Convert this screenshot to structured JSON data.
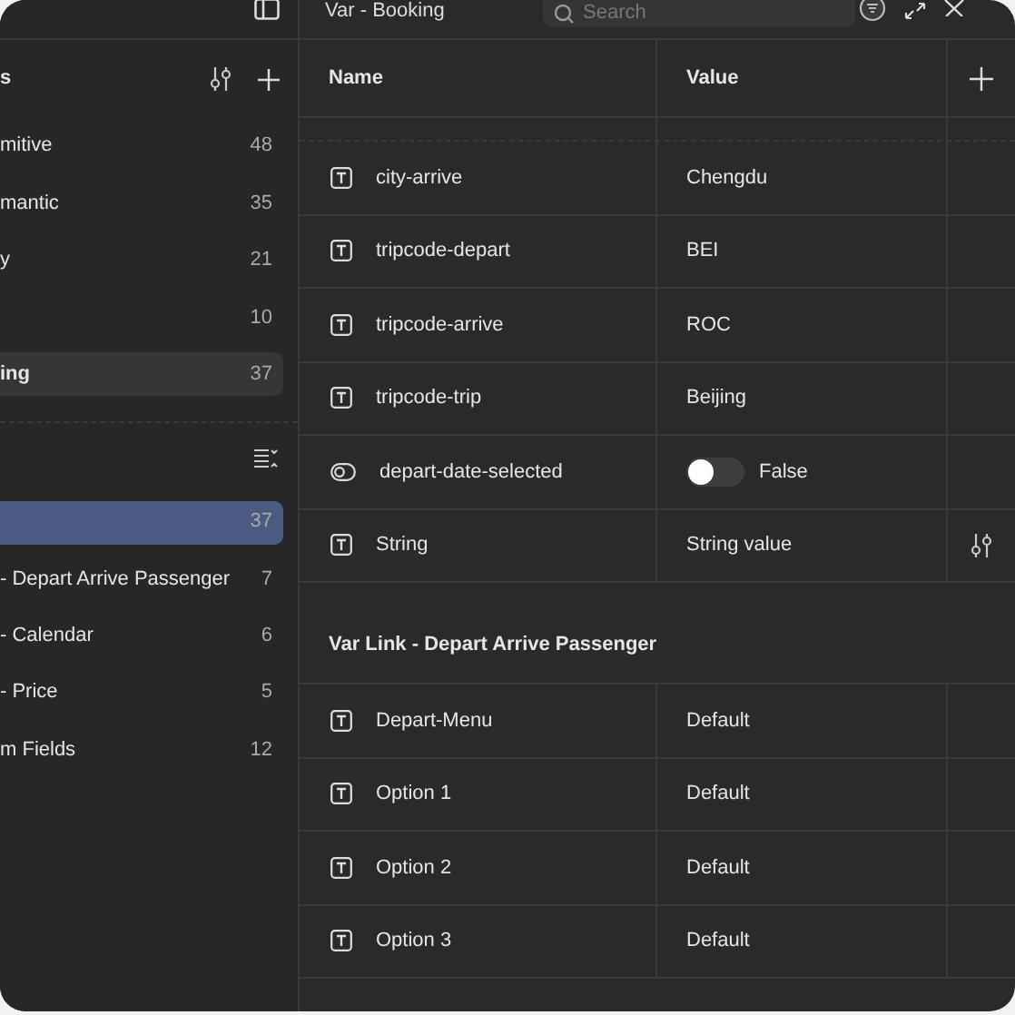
{
  "window": {
    "title": "Var - Booking"
  },
  "search": {
    "placeholder": "Search"
  },
  "sidebar": {
    "groups": [
      {
        "header": "s",
        "items": [
          {
            "label": "mitive",
            "count": "48",
            "selected": false
          },
          {
            "label": "mantic",
            "count": "35",
            "selected": false
          },
          {
            "label": "y",
            "count": "21",
            "selected": false
          },
          {
            "count": "10",
            "selected": false
          },
          {
            "label": "ing",
            "count": "37",
            "selected": true
          }
        ]
      },
      {
        "items": [
          {
            "count": "37",
            "selected": true
          },
          {
            "label": "- Depart Arrive Passenger",
            "count": "7",
            "selected": false
          },
          {
            "label": "- Calendar",
            "count": "6",
            "selected": false
          },
          {
            "label": "- Price",
            "count": "5",
            "selected": false
          },
          {
            "label": "m Fields",
            "count": "12",
            "selected": false
          }
        ]
      }
    ]
  },
  "table": {
    "columns": [
      "Name",
      "Value"
    ],
    "sections": [
      {
        "rows": [
          {
            "kind": "string",
            "name": "city-arrive",
            "value": "Chengdu",
            "hovered": false
          },
          {
            "kind": "string",
            "name": "tripcode-depart",
            "value": "BEI",
            "hovered": false
          },
          {
            "kind": "string",
            "name": "tripcode-arrive",
            "value": "ROC",
            "hovered": false
          },
          {
            "kind": "string",
            "name": "tripcode-trip",
            "value": "Beijing",
            "hovered": false
          },
          {
            "kind": "boolean",
            "name": "depart-date-selected",
            "value": "False",
            "on": false,
            "hovered": false
          },
          {
            "kind": "string",
            "name": "String",
            "value": "String value",
            "hovered": true
          }
        ]
      },
      {
        "title": "Var Link - Depart Arrive Passenger",
        "rows": [
          {
            "kind": "string",
            "name": "Depart-Menu",
            "value": "Default",
            "hovered": false
          },
          {
            "kind": "string",
            "name": "Option 1",
            "value": "Default",
            "hovered": false
          },
          {
            "kind": "string",
            "name": "Option 2",
            "value": "Default",
            "hovered": false
          },
          {
            "kind": "string",
            "name": "Option 3",
            "value": "Default",
            "hovered": false
          }
        ]
      }
    ]
  }
}
